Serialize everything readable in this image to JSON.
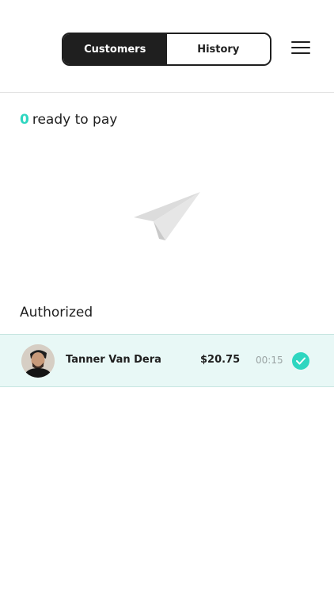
{
  "header": {
    "tabs": [
      {
        "label": "Customers",
        "active": true
      },
      {
        "label": "History",
        "active": false
      }
    ],
    "menu_icon": "hamburger-menu-icon"
  },
  "ready": {
    "count": "0",
    "label": "ready to pay",
    "accent_color": "#2ed6c0"
  },
  "empty_state": {
    "icon": "paper-plane-icon"
  },
  "authorized": {
    "title": "Authorized",
    "items": [
      {
        "name": "Tanner Van Dera",
        "amount": "$20.75",
        "time": "00:15",
        "status_icon": "check-circle-icon"
      }
    ]
  }
}
